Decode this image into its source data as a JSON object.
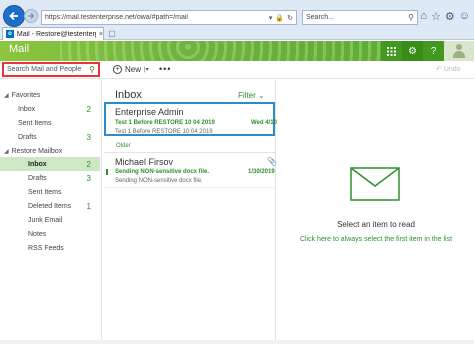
{
  "browser": {
    "address": "https://mail.testenterprise.net/owa/#path=/mail",
    "search_placeholder": "Search...",
    "tab_title": "Mail - Restore@testenterpri...",
    "tab_close": "×",
    "new_tab": "▢"
  },
  "app": {
    "name": "Mail",
    "search_placeholder": "Search Mail and People",
    "new_label": "New",
    "more": "•••",
    "undo_label": "Undo"
  },
  "nav": {
    "favorites": "Favorites",
    "fav_inbox": "Inbox",
    "fav_inbox_count": "2",
    "fav_sent": "Sent Items",
    "fav_drafts": "Drafts",
    "fav_drafts_count": "3",
    "mailbox": "Restore Mailbox",
    "inbox": "Inbox",
    "inbox_count": "2",
    "drafts": "Drafts",
    "drafts_count": "3",
    "sent": "Sent Items",
    "deleted": "Deleted Items",
    "deleted_count": "1",
    "junk": "Junk Email",
    "notes": "Notes",
    "rss": "RSS Feeds"
  },
  "list": {
    "title": "Inbox",
    "filter": "Filter",
    "older": "Older",
    "messages": [
      {
        "sender": "Enterprise Admin",
        "subject": "Test 1 Before RESTORE 10 04 2019",
        "date": "Wed 4/10",
        "preview": "Test 1 Before RESTORE 10 04 2019"
      },
      {
        "sender": "Michael Firsov",
        "subject": "Sending NON-sensitive docx file.",
        "date": "1/30/2019",
        "preview": "Sending NON-sensitive docx file."
      }
    ]
  },
  "reading": {
    "empty_title": "Select an item to read",
    "empty_link": "Click here to always select the first item in the list"
  },
  "colors": {
    "accent": "#2f8f2f",
    "header": "#6db33f",
    "selection_border": "#2a8cc9",
    "search_highlight": "#e8343c"
  }
}
